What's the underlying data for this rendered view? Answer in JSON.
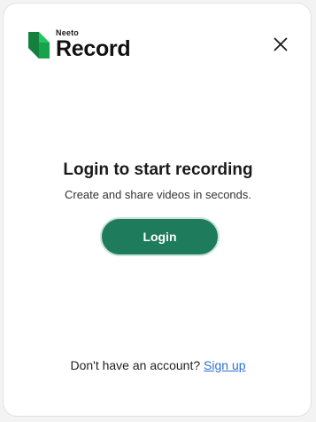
{
  "app": {
    "brand_small": "Neeto",
    "brand_big": "Record",
    "brand_color": "#22c55e"
  },
  "header": {
    "close_icon": "close-icon"
  },
  "main": {
    "title": "Login to start recording",
    "subtitle": "Create and share videos in seconds.",
    "login_label": "Login",
    "accent": "#1e7b5b"
  },
  "footer": {
    "prompt": "Don't have an account?",
    "signup_label": "Sign up",
    "link_color": "#2f6fd1"
  }
}
